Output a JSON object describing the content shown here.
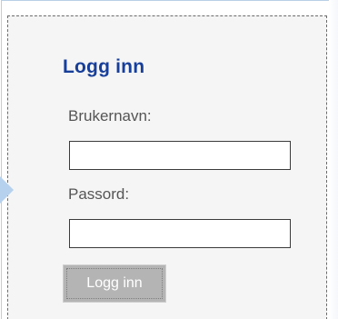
{
  "login": {
    "title": "Logg inn",
    "username_label": "Brukernavn:",
    "username_value": "",
    "password_label": "Passord:",
    "password_value": "",
    "submit_label": "Logg inn"
  },
  "colors": {
    "title": "#173f9a",
    "label": "#555555",
    "button_bg": "#b4b4b4",
    "panel_bg": "#f5f5f5",
    "pointer": "#b6d1ee"
  },
  "icons": {
    "pointer": "arrow-pointer-icon"
  }
}
